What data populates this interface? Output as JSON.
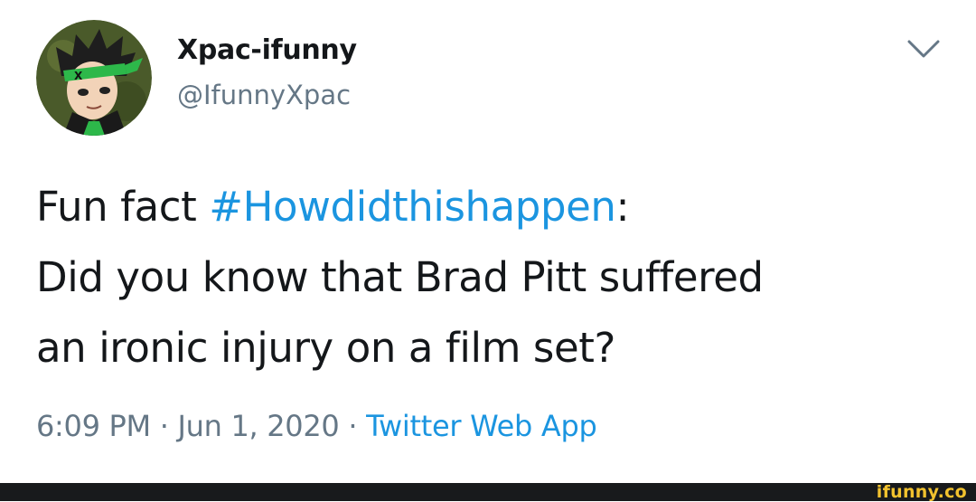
{
  "tweet": {
    "author": {
      "display_name": "Xpac-ifunny",
      "handle": "@IfunnyXpac"
    },
    "text": {
      "line1_prefix": "Fun fact ",
      "hashtag": "#Howdidthishappen",
      "line1_suffix": ":",
      "line2": "Did you know that Brad Pitt suffered",
      "line3": "an ironic injury on a film set?"
    },
    "meta": {
      "time": "6:09 PM",
      "separator1": " · ",
      "date": "Jun 1, 2020",
      "separator2": " · ",
      "source": "Twitter Web App"
    },
    "menu_icon": "chevron-down-icon"
  },
  "footer": {
    "watermark": "ifunny.co"
  },
  "colors": {
    "text": "#14171a",
    "secondary": "#657786",
    "link": "#1b95e0",
    "footer_bg": "#181a1c",
    "watermark": "#f2c22e"
  }
}
